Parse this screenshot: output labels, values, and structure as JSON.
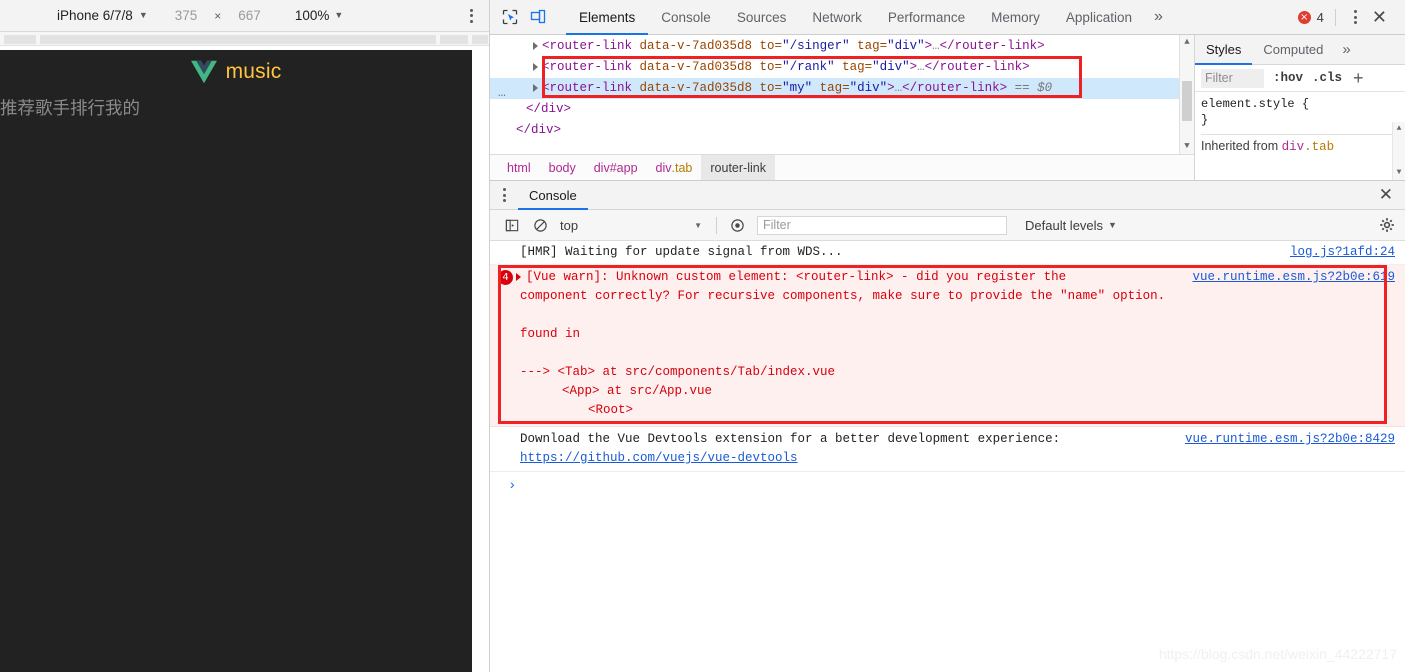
{
  "device_toolbar": {
    "device_name": "iPhone 6/7/8",
    "width": "375",
    "separator": "×",
    "height": "667",
    "zoom": "100%",
    "caret": "▼",
    "menu_icon": "kebab-menu-icon"
  },
  "phone": {
    "app_title": "music",
    "logo_icon": "vue-logo-icon",
    "title_color": "#ffc53d",
    "bg_color": "#222222",
    "tabs": [
      {
        "label": "推荐"
      },
      {
        "label": "歌手"
      },
      {
        "label": "排行"
      },
      {
        "label": "我的"
      }
    ]
  },
  "devtools": {
    "icons": {
      "inspect": "inspect-element-icon",
      "device_toggle": "device-toolbar-toggle-icon"
    },
    "tabs": [
      {
        "label": "Elements",
        "active": true
      },
      {
        "label": "Console",
        "active": false
      },
      {
        "label": "Sources",
        "active": false
      },
      {
        "label": "Network",
        "active": false
      },
      {
        "label": "Performance",
        "active": false
      },
      {
        "label": "Memory",
        "active": false
      },
      {
        "label": "Application",
        "active": false
      }
    ],
    "more_tabs": "»",
    "error_count": "4",
    "error_icon": "error-circle-icon",
    "menu_icon": "kebab-menu-icon",
    "close_icon": "close-icon",
    "accent_color": "#1a73e8"
  },
  "dom": {
    "lines": [
      {
        "id": "l1",
        "tag_open": "<router-link",
        "attr1": " data-v-7ad035d8",
        "attr2_name": " to=",
        "attr2_val": "\"/singer\"",
        "attr3_name": " tag=",
        "attr3_val": "\"div\"",
        "gt": ">",
        "ellipsis": "…",
        "tag_close": "</router-link>",
        "selected": false
      },
      {
        "id": "l2",
        "tag_open": "<router-link",
        "attr1": " data-v-7ad035d8",
        "attr2_name": " to=",
        "attr2_val": "\"/rank\"",
        "attr3_name": " tag=",
        "attr3_val": "\"div\"",
        "gt": ">",
        "ellipsis": "…",
        "tag_close": "</router-link>",
        "selected": false
      },
      {
        "id": "l3",
        "tag_open": "<router-link",
        "attr1": " data-v-7ad035d8",
        "attr2_name": " to=",
        "attr2_val": "\"my\"",
        "attr3_name": " tag=",
        "attr3_val": "\"div\"",
        "gt": ">",
        "ellipsis": "…",
        "tag_close": "</router-link>",
        "selected_marker": " == $0",
        "selected": true
      }
    ],
    "close_div_1": "</div>",
    "close_div_2": "</div>",
    "dots": "…",
    "highlight_color": "#ee2222"
  },
  "breadcrumb": {
    "items": [
      {
        "text": "html",
        "active": false
      },
      {
        "text": "body",
        "active": false
      },
      {
        "text": "div#app",
        "active": false
      },
      {
        "text": "div",
        "cls": ".tab",
        "active": false
      },
      {
        "text": "router-link",
        "active": true
      }
    ]
  },
  "styles": {
    "tabs": [
      {
        "label": "Styles",
        "active": true
      },
      {
        "label": "Computed",
        "active": false
      }
    ],
    "more": "»",
    "filter_placeholder": "Filter",
    "hov": ":hov",
    "cls": ".cls",
    "plus": "+",
    "rule_selector": "element.style {",
    "rule_close": "}",
    "inherited_label": "Inherited from",
    "inherited_tag": "div",
    "inherited_class": ".tab"
  },
  "drawer": {
    "menu_icon": "kebab-menu-icon",
    "tab_label": "Console",
    "close_icon": "close-icon"
  },
  "console_toolbar": {
    "clear_icon": "clear-console-icon",
    "no_entry_icon": "no-entry-icon",
    "context": "top",
    "caret": "▼",
    "eye_icon": "live-expression-icon",
    "filter_placeholder": "Filter",
    "levels": "Default levels",
    "settings_icon": "gear-icon"
  },
  "console": {
    "hmr_message": "[HMR] Waiting for update signal from WDS...",
    "hmr_source": "log.js?1afd:24",
    "error_count": "4",
    "error_line1": "[Vue warn]: Unknown custom element: <router-link> - did you register the",
    "error_line2": "component correctly? For recursive components, make sure to provide the \"name\" option.",
    "error_source": "vue.runtime.esm.js?2b0e:619",
    "found_in": "found in",
    "trace_line1": "---> <Tab> at src/components/Tab/index.vue",
    "trace_line2": "<App> at src/App.vue",
    "trace_line3": "<Root>",
    "devtools_message": "Download the Vue Devtools extension for a better development experience:",
    "devtools_link": "https://github.com/vuejs/vue-devtools",
    "devtools_source": "vue.runtime.esm.js?2b0e:8429",
    "prompt": "›",
    "error_color": "#d8000c",
    "link_color": "#1a5ad8"
  },
  "watermark": "https://blog.csdn.net/weixin_44222717"
}
